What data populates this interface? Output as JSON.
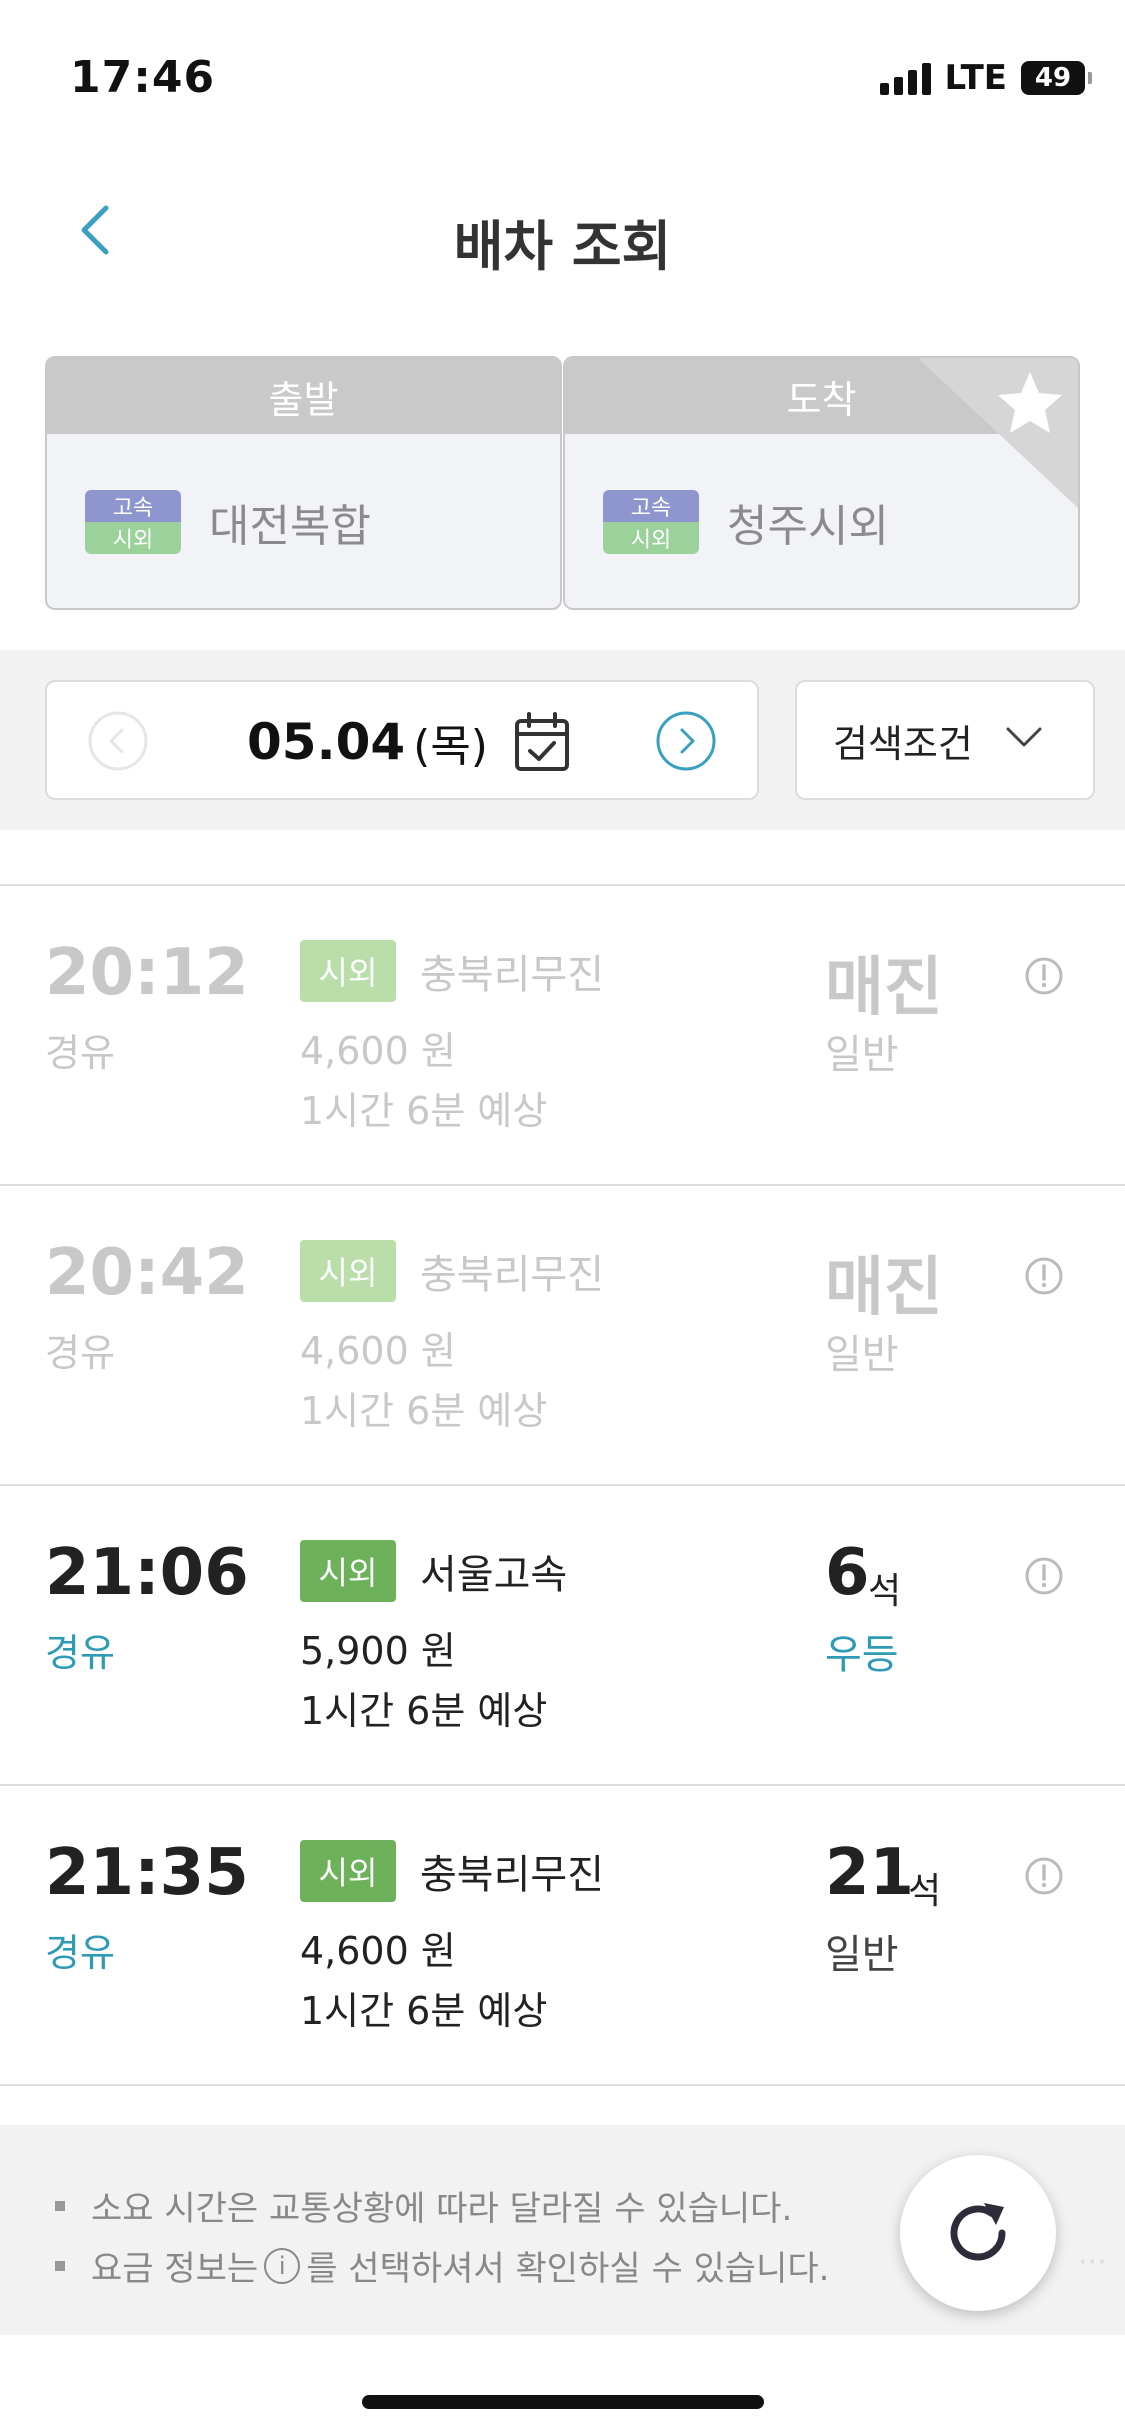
{
  "status": {
    "time": "17:46",
    "network": "LTE",
    "battery": "49"
  },
  "header": {
    "title": "배차 조회"
  },
  "route": {
    "departure": {
      "label": "출발",
      "badge_top": "고속",
      "badge_bottom": "시외",
      "name": "대전복합"
    },
    "arrival": {
      "label": "도착",
      "badge_top": "고속",
      "badge_bottom": "시외",
      "name": "청주시외"
    }
  },
  "date": {
    "value": "05.04",
    "weekday": "(목)"
  },
  "filter": {
    "label": "검색조건"
  },
  "schedules": [
    {
      "time": "20:12",
      "via": "경유",
      "company_type": "시외",
      "company": "충북리무진",
      "fare": "4,600 원",
      "duration": "1시간 6분 예상",
      "seats": "매진",
      "seat_unit": "",
      "grade": "일반",
      "sold_out": true
    },
    {
      "time": "20:42",
      "via": "경유",
      "company_type": "시외",
      "company": "충북리무진",
      "fare": "4,600 원",
      "duration": "1시간 6분 예상",
      "seats": "매진",
      "seat_unit": "",
      "grade": "일반",
      "sold_out": true
    },
    {
      "time": "21:06",
      "via": "경유",
      "company_type": "시외",
      "company": "서울고속",
      "fare": "5,900 원",
      "duration": "1시간 6분 예상",
      "seats": "6",
      "seat_unit": "석",
      "grade": "우등",
      "sold_out": false
    },
    {
      "time": "21:35",
      "via": "경유",
      "company_type": "시외",
      "company": "충북리무진",
      "fare": "4,600 원",
      "duration": "1시간 6분 예상",
      "seats": "21",
      "seat_unit": "석",
      "grade": "일반",
      "sold_out": false
    }
  ],
  "notes": {
    "line1": "소요 시간은 교통상황에 따라 달라질 수 있습니다.",
    "line2_before": "요금 정보는",
    "line2_icon": "i",
    "line2_after": "를 선택하셔서 확인하실 수 있습니다."
  },
  "colors": {
    "accent": "#2f9ab6",
    "badge_green": "#6db25a",
    "header_gray": "#c9c9c9"
  }
}
